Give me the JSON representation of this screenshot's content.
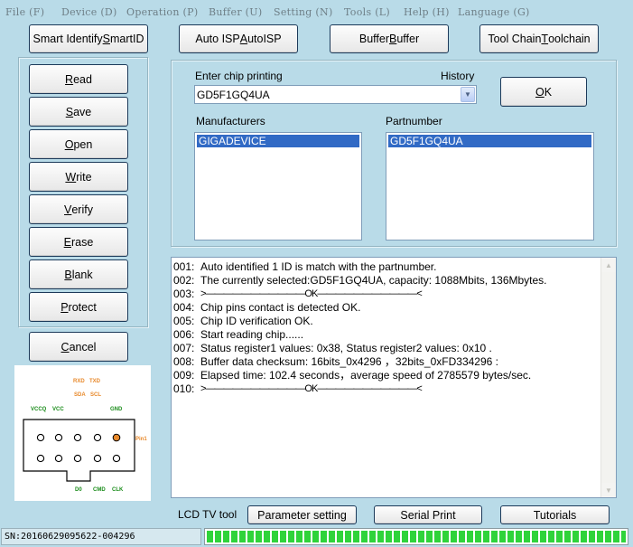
{
  "menu": [
    {
      "label": "File (F)"
    },
    {
      "label": "Device (D)"
    },
    {
      "label": "Operation (P)"
    },
    {
      "label": "Buffer (U)"
    },
    {
      "label": "Setting (N)"
    },
    {
      "label": "Tools (L)"
    },
    {
      "label": "Help (H)"
    },
    {
      "label": "Language (G)"
    }
  ],
  "toolbar": {
    "smart_identify": {
      "pre": "Smart Identify ",
      "accel": "S",
      "post": "martID"
    },
    "auto_isp": {
      "pre": "Auto ISP ",
      "accel": "A",
      "post": "utoISP"
    },
    "buffer": {
      "pre": "Buffer ",
      "accel": "B",
      "post": "uffer"
    },
    "tool_chain": {
      "pre": "Tool Chain ",
      "accel": "T",
      "post": "oolchain"
    }
  },
  "side_buttons": [
    {
      "accel": "R",
      "post": "ead"
    },
    {
      "accel": "S",
      "post": "ave"
    },
    {
      "accel": "O",
      "post": "pen"
    },
    {
      "accel": "W",
      "post": "rite"
    },
    {
      "accel": "V",
      "post": "erify"
    },
    {
      "accel": "E",
      "post": "rase"
    },
    {
      "accel": "B",
      "post": "lank"
    },
    {
      "accel": "P",
      "post": "rotect"
    }
  ],
  "cancel": {
    "accel": "C",
    "post": "ancel"
  },
  "chip": {
    "enter_label": "Enter chip printing",
    "history_label": "History",
    "value": "GD5F1GQ4UA",
    "ok": {
      "accel": "O",
      "post": "K"
    }
  },
  "manufacturers": {
    "label": "Manufacturers",
    "selected": "GIGADEVICE"
  },
  "partnumber": {
    "label": "Partnumber",
    "selected": "GD5F1GQ4UA"
  },
  "log": [
    {
      "num": "001:",
      "text": "Auto identified 1 ID is match with the partnumber."
    },
    {
      "num": "002:",
      "text": "The currently selected:GD5F1GQ4UA, capacity: 1088Mbits, 136Mbytes."
    },
    {
      "num": "003:",
      "text": ">———————————OK———————————<"
    },
    {
      "num": "004:",
      "text": "Chip pins contact is detected OK."
    },
    {
      "num": "005:",
      "text": "Chip ID verification OK."
    },
    {
      "num": "006:",
      "text": "Start reading chip......"
    },
    {
      "num": "007:",
      "text": "Status register1 values: 0x38, Status register2 values: 0x10 ."
    },
    {
      "num": "008:",
      "text": "Buffer data checksum: 16bits_0x4296 ，32bits_0xFD334296 :"
    },
    {
      "num": "009:",
      "text": "Elapsed time: 102.4 seconds，average speed of 2785579 bytes/sec."
    },
    {
      "num": "010:",
      "text": ">———————————OK———————————<"
    }
  ],
  "diagram": {
    "rxd": "RXD",
    "txd": "TXD",
    "sda": "SDA",
    "scl": "SCL",
    "vccq": "VCCQ",
    "vcc": "VCC",
    "gnd": "GND",
    "pin1": "Pin1",
    "d0": "D0",
    "cmd": "CMD",
    "clk": "CLK"
  },
  "bottom": {
    "lcd_label": "LCD TV tool",
    "parameter_setting": "Parameter setting",
    "serial_print": "Serial Print",
    "tutorials": "Tutorials"
  },
  "status": {
    "sn": "SN:20160629095622-004296",
    "progress_fraction": 1.0
  },
  "colors": {
    "background": "#b9dbe8",
    "selection": "#316ac5",
    "progress": "#2fd33a",
    "diagram_orange": "#e8892b",
    "diagram_green": "#1a8c1a"
  }
}
